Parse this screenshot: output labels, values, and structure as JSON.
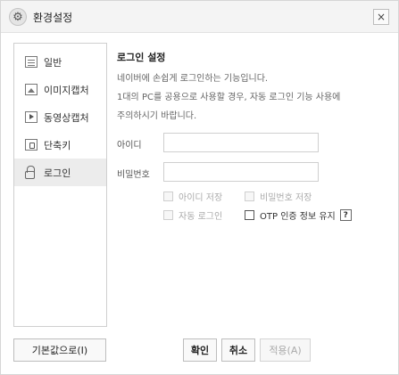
{
  "window": {
    "title": "환경설정",
    "settings_icon_glyph": "⚙",
    "close_glyph": "×"
  },
  "sidebar": {
    "items": [
      {
        "label": "일반",
        "icon": "general-icon"
      },
      {
        "label": "이미지캡처",
        "icon": "image-capture-icon"
      },
      {
        "label": "동영상캡처",
        "icon": "video-capture-icon"
      },
      {
        "label": "단축키",
        "icon": "shortcut-icon"
      },
      {
        "label": "로그인",
        "icon": "lock-icon",
        "active": true
      }
    ]
  },
  "login": {
    "section_title": "로그인 설정",
    "description_line1": "네이버에 손쉽게 로그인하는 기능입니다.",
    "description_line2": "1대의 PC를 공용으로 사용할 경우, 자동 로그인 기능 사용에",
    "description_line3": "주의하시기 바랍니다.",
    "id_label": "아이디",
    "id_value": "",
    "password_label": "비밀번호",
    "password_value": "",
    "options": {
      "save_id": {
        "label": "아이디 저장",
        "checked": false,
        "enabled": false
      },
      "save_password": {
        "label": "비밀번호 저장",
        "checked": false,
        "enabled": false
      },
      "auto_login": {
        "label": "자동 로그인",
        "checked": false,
        "enabled": false
      },
      "otp_keep": {
        "label": "OTP 인증 정보 유지",
        "checked": false,
        "enabled": true
      }
    },
    "help_label": "?"
  },
  "buttons": {
    "defaults": "기본값으로(I)",
    "ok": "확인",
    "cancel": "취소",
    "apply": "적용(A)"
  },
  "colors": {
    "border": "#cfcfcf",
    "active_item_bg": "#ececec",
    "disabled_text": "#aaaaaa"
  }
}
